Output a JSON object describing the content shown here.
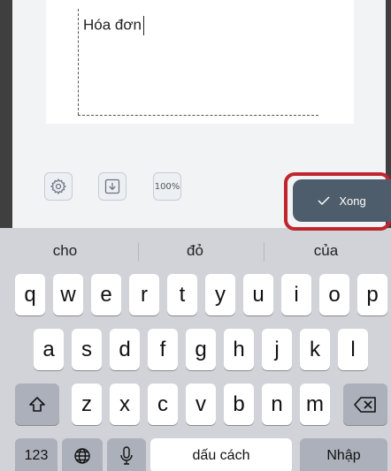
{
  "document": {
    "text": "Hóa đơn"
  },
  "toolbar": {
    "settings_icon": "gear-icon",
    "import_icon": "download-box-icon",
    "zoom_label": "100%"
  },
  "done_button": {
    "label": "Xong",
    "icon": "checkmark-icon",
    "highlight_color": "#c0262e"
  },
  "keyboard": {
    "suggestions": [
      "cho",
      "đỏ",
      "của"
    ],
    "row1": [
      "q",
      "w",
      "e",
      "r",
      "t",
      "y",
      "u",
      "i",
      "o",
      "p"
    ],
    "row2": [
      "a",
      "s",
      "d",
      "f",
      "g",
      "h",
      "j",
      "k",
      "l"
    ],
    "row3": [
      "z",
      "x",
      "c",
      "v",
      "b",
      "n",
      "m"
    ],
    "numbers_label": "123",
    "space_label": "dấu cách",
    "return_label": "Nhập"
  }
}
